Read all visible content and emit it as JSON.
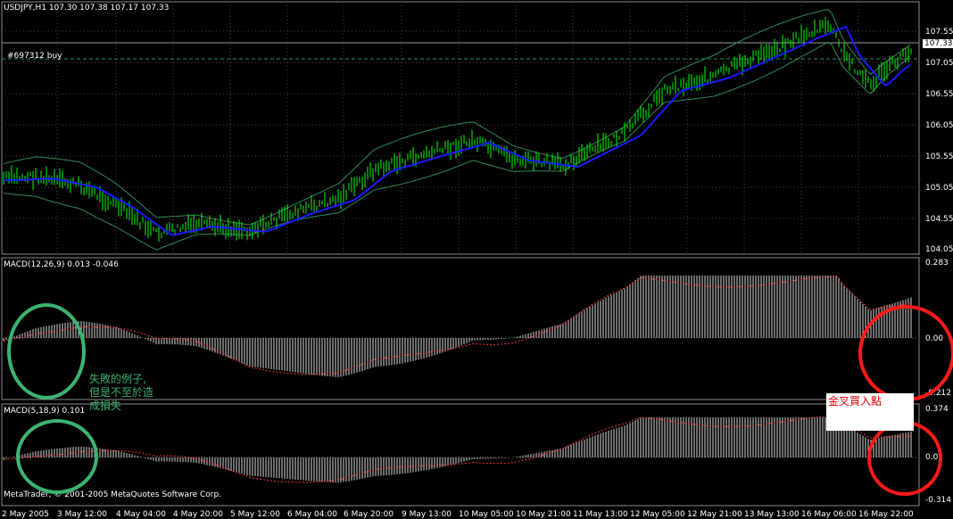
{
  "main_chart": {
    "title": "USDJPY,H1  107.30 107.38 107.17 107.33",
    "order_label": "#697312 buy",
    "current_price": "107.33",
    "y_axis": [
      "107.55",
      "107.05",
      "106.55",
      "106.05",
      "105.55",
      "105.05",
      "104.55",
      "104.05"
    ],
    "colors": {
      "candles": "#00ff00",
      "ma": "#1a1aff",
      "bands": "#2e8b57",
      "grid": "#444444"
    }
  },
  "macd1": {
    "title": "MACD(12,26,9) 0.013 -0.046",
    "y_axis": [
      "0.283",
      "0.00",
      "-0.212"
    ]
  },
  "macd2": {
    "title": "MACD(5,18,9) 0.101",
    "y_axis": [
      "0.374",
      "0.0",
      "-0.314"
    ]
  },
  "annotations": {
    "green_note": "失敗的例子,\n但是不至於造\n成損失",
    "red_note": "金叉買入點"
  },
  "footer": "MetaTrader, © 2001-2005 MetaQuotes Software Corp.",
  "x_axis": [
    "2 May 2005",
    "3 May 12:00",
    "4 May 04:00",
    "4 May 20:00",
    "5 May 12:00",
    "6 May 04:00",
    "6 May 20:00",
    "9 May 13:00",
    "10 May 05:00",
    "10 May 21:00",
    "11 May 13:00",
    "12 May 05:00",
    "12 May 21:00",
    "13 May 13:00",
    "16 May 06:00",
    "16 May 22:00"
  ]
}
